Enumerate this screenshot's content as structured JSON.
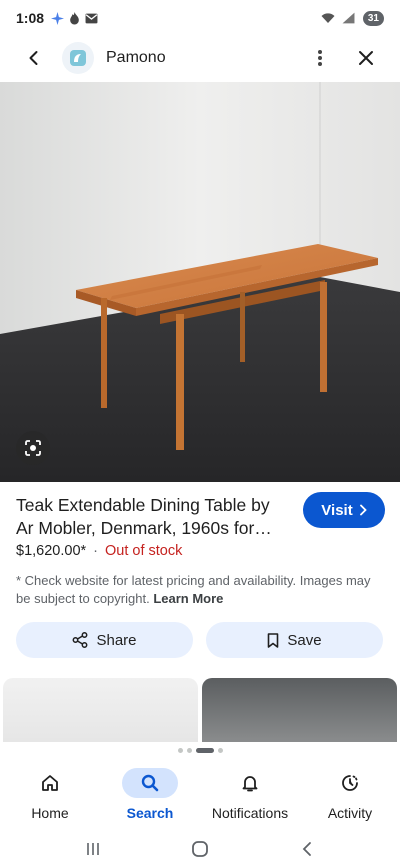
{
  "status_bar": {
    "time": "1:08",
    "battery": "31",
    "icons": [
      "gemini-spark-icon",
      "fire-icon",
      "mail-icon",
      "wifi-icon",
      "signal-icon"
    ]
  },
  "header": {
    "site_name": "Pamono",
    "icons": [
      "back-arrow-icon",
      "site-logo-icon",
      "more-vert-icon",
      "close-icon"
    ]
  },
  "hero": {
    "subject": "teak-extendable-dining-table",
    "lens_icon": "google-lens-icon"
  },
  "product": {
    "title": "Teak Extendable Dining Table by Ar Mobler, Denmark, 1960s for…",
    "visit_label": "Visit",
    "price": "$1,620.00*",
    "separator": "·",
    "stock_status": "Out of stock",
    "disclaimer": "* Check website for latest pricing and availability. Images may be subject to copyright.",
    "learn_more": "Learn More"
  },
  "actions": {
    "share_label": "Share",
    "save_label": "Save"
  },
  "bottom_nav": {
    "items": [
      {
        "label": "Home",
        "icon": "home-icon",
        "active": false
      },
      {
        "label": "Search",
        "icon": "search-icon",
        "active": true
      },
      {
        "label": "Notifications",
        "icon": "bell-icon",
        "active": false
      },
      {
        "label": "Activity",
        "icon": "activity-icon",
        "active": false
      }
    ]
  },
  "colors": {
    "accent": "#0b57d0",
    "active_pill": "#d3e3fd",
    "out_of_stock": "#c5221f",
    "action_bg": "#e8f0fe"
  }
}
